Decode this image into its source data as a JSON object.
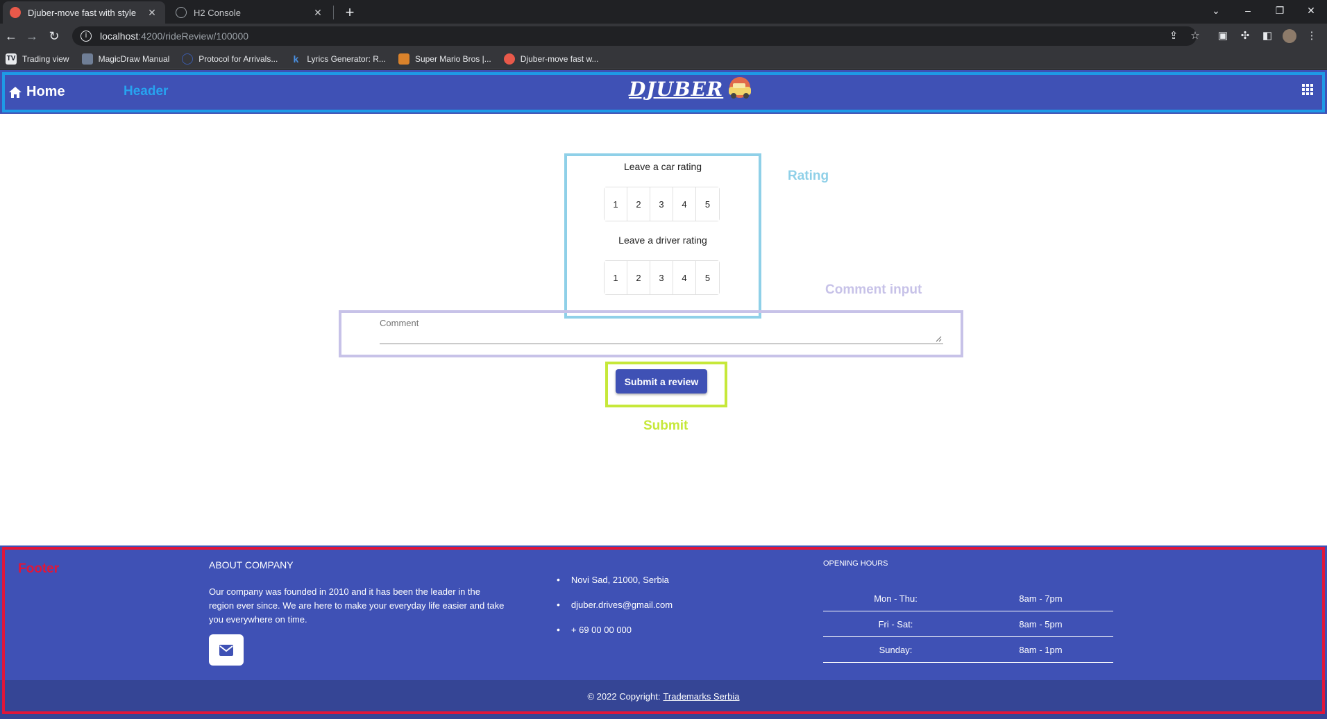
{
  "browser": {
    "tabs": [
      {
        "title": "Djuber-move fast with style",
        "active": true
      },
      {
        "title": "H2 Console",
        "active": false
      }
    ],
    "url_host": "localhost",
    "url_path": ":4200/rideReview/100000",
    "bookmarks": [
      {
        "label": "Trading view",
        "icon": "TV"
      },
      {
        "label": "MagicDraw Manual",
        "icon": "md"
      },
      {
        "label": "Protocol for Arrivals...",
        "icon": "globe"
      },
      {
        "label": "Lyrics Generator: R...",
        "icon": "k"
      },
      {
        "label": "Super Mario Bros |...",
        "icon": "mario"
      },
      {
        "label": "Djuber-move fast w...",
        "icon": "djuber"
      }
    ]
  },
  "header": {
    "home_label": "Home",
    "logo_text": "DJUBER",
    "annotation": "Header"
  },
  "rating": {
    "car_label": "Leave a car rating",
    "driver_label": "Leave a driver rating",
    "options": [
      "1",
      "2",
      "3",
      "4",
      "5"
    ],
    "annotation": "Rating"
  },
  "comment": {
    "placeholder": "Comment",
    "annotation": "Comment input"
  },
  "submit": {
    "label": "Submit a review",
    "annotation": "Submit"
  },
  "footer": {
    "annotation": "Footer",
    "about_title": "ABOUT COMPANY",
    "about_text": "Our company was founded in 2010 and it has been the leader in the region ever since. We are here to make your everyday life easier and take you everywhere on time.",
    "contacts": [
      "Novi Sad, 21000, Serbia",
      "djuber.drives@gmail.com",
      "+ 69 00 00 000"
    ],
    "hours_title": "OPENING HOURS",
    "hours": [
      {
        "day": "Mon - Thu:",
        "time": "8am - 7pm"
      },
      {
        "day": "Fri - Sat:",
        "time": "8am - 5pm"
      },
      {
        "day": "Sunday:",
        "time": "8am - 1pm"
      }
    ],
    "copyright_prefix": "© 2022 Copyright:",
    "copyright_link": "Trademarks Serbia"
  },
  "colors": {
    "primary": "#3f51b5",
    "header_annotation": "#1e9ae6",
    "rating_annotation": "#8fd0e8",
    "comment_annotation": "#c7c2e8",
    "submit_annotation": "#c6e83a",
    "footer_annotation": "#e0163a"
  }
}
